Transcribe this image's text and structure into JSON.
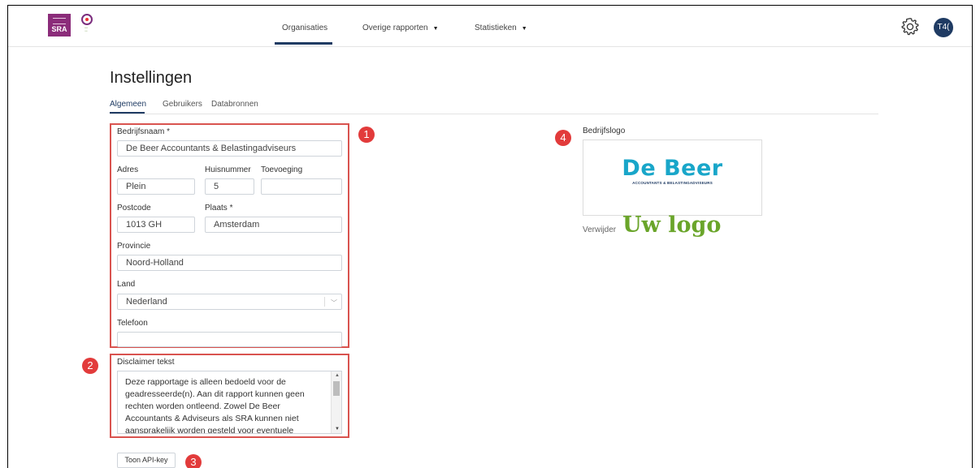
{
  "header": {
    "brand": {
      "sra_text": "SRA"
    },
    "nav": [
      {
        "label": "Organisaties",
        "has_dropdown": false,
        "active": true
      },
      {
        "label": "Overige rapporten",
        "has_dropdown": true
      },
      {
        "label": "Statistieken",
        "has_dropdown": true
      }
    ],
    "avatar_initials": "T4(",
    "icons": {
      "settings": "gear-icon",
      "dropdown": "caret-down-icon"
    },
    "accent_color": "#1f3b63"
  },
  "page": {
    "title": "Instellingen",
    "tabs": [
      {
        "label": "Algemeen",
        "active": true
      },
      {
        "label": "Gebruikers"
      },
      {
        "label": "Databronnen"
      }
    ]
  },
  "form": {
    "bedrijfsnaam": {
      "label": "Bedrijfsnaam *",
      "value": "De Beer Accountants & Belastingadviseurs"
    },
    "adres": {
      "label": "Adres",
      "value": "Plein"
    },
    "huisnummer": {
      "label": "Huisnummer",
      "value": "5"
    },
    "toevoeging": {
      "label": "Toevoeging",
      "value": ""
    },
    "postcode": {
      "label": "Postcode",
      "value": "1013 GH"
    },
    "plaats": {
      "label": "Plaats *",
      "value": "Amsterdam"
    },
    "provincie": {
      "label": "Provincie",
      "value": "Noord-Holland"
    },
    "land": {
      "label": "Land",
      "value": "Nederland"
    },
    "telefoon": {
      "label": "Telefoon",
      "value": ""
    }
  },
  "disclaimer": {
    "label": "Disclaimer tekst",
    "text": "Deze rapportage is alleen bedoeld voor de geadresseerde(n). Aan dit rapport kunnen geen rechten worden ontleend. Zowel De Beer Accountants & Adviseurs als SRA kunnen niet aansprakelijk worden gesteld voor eventuele"
  },
  "api_button": {
    "label": "Toon API-key"
  },
  "logo": {
    "label": "Bedrijfslogo",
    "company_name": "De Beer",
    "company_sub": "ACCOUNTANTS & BELASTINGADVISEURS",
    "remove_label": "Verwijder",
    "overlay_text": "Uw logo"
  },
  "annotations": {
    "badge_1": "1",
    "badge_2": "2",
    "badge_3": "3",
    "badge_4": "4",
    "color": "#e23b3b"
  }
}
